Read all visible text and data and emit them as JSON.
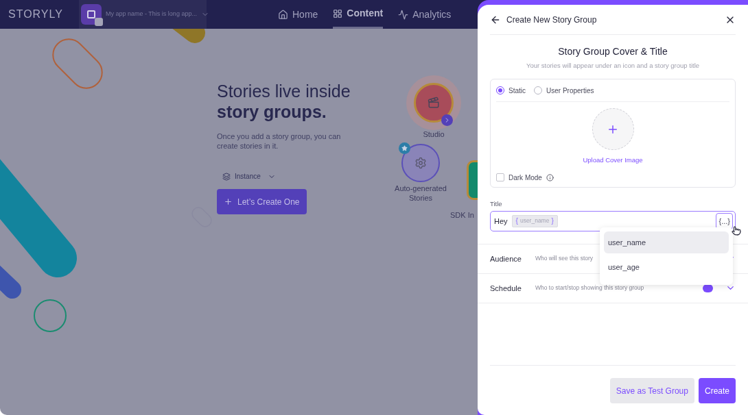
{
  "nav": {
    "logo": "STORYLY",
    "app_name": "My app name - This is long app...",
    "items": [
      {
        "kind": "home",
        "label": "Home",
        "selected": false
      },
      {
        "kind": "grid",
        "label": "Content",
        "selected": true
      },
      {
        "kind": "pulse",
        "label": "Analytics",
        "selected": false
      }
    ]
  },
  "empty_state": {
    "heading": "Stories live inside **story groups.**",
    "description": "Once you add a story group, you can create stories in it.",
    "instance": "Instance",
    "create_button": "Let’s Create One",
    "features": [
      {
        "kind": "studio",
        "label": "Studio"
      },
      {
        "kind": "auto",
        "label": "Auto-generated Stories"
      },
      {
        "kind": "sdk",
        "label": "SDK In"
      }
    ]
  },
  "panel": {
    "title": "Create New Story Group",
    "section_title": "Story Group Cover & Title",
    "section_subtitle": "Your stories will appear under an icon and a story group title",
    "cover_modes": [
      {
        "label": "Static",
        "selected": true
      },
      {
        "label": "User Properties",
        "selected": false
      }
    ],
    "upload_label": "Upload Cover Image",
    "dark_mode": {
      "label": "Dark Mode",
      "checked": false
    },
    "title_field": {
      "label": "Title",
      "value": "Hey",
      "token": {
        "open": "{",
        "name": "user_name",
        "close": "}"
      },
      "insert_button": "{...}"
    },
    "variable_menu": [
      {
        "label": "user_name",
        "selected": true
      },
      {
        "label": "user_age",
        "selected": false
      }
    ],
    "sections": [
      {
        "label": "Audience",
        "description": "Who will see this story"
      },
      {
        "label": "Schedule",
        "description": "Who to start/stop showing this story group"
      }
    ],
    "buttons": {
      "secondary": "Save as Test Group",
      "primary": "Create"
    }
  }
}
